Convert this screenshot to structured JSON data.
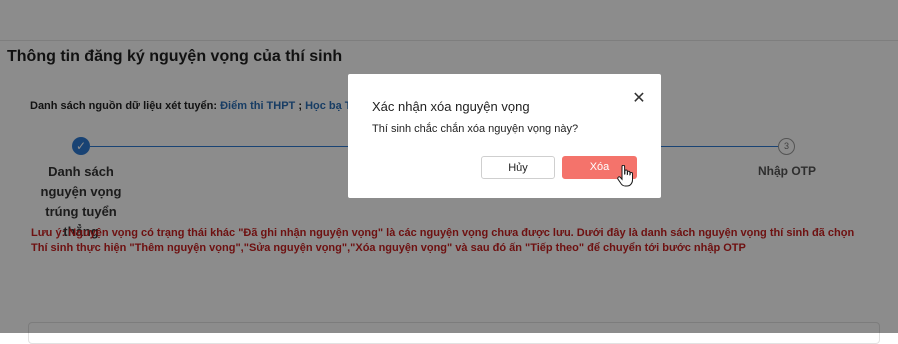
{
  "card": {
    "title": "Thông tin đăng ký nguyện vọng của thí sinh",
    "sources_label": "Danh sách nguồn dữ liệu xét tuyển:",
    "source_1": "Điểm thi THPT",
    "separator": ";",
    "source_2": "Học bạ TH"
  },
  "steps": {
    "step1_label": "Danh sách nguyện vọng trúng tuyển thẳng",
    "step1_icon": "check-icon",
    "step2_number": "3",
    "step2_label": "Nhập OTP",
    "active_color": "#2e7bd3"
  },
  "note": {
    "line1": "Lưu ý: Nguyện vọng có trạng thái khác \"Đã ghi nhận nguyện vọng\" là các nguyện vọng chưa được lưu. Dưới đây là danh sách nguyện vọng thí sinh đã chọn",
    "line2": "Thí sinh thực hiện \"Thêm nguyện vọng\",\"Sửa nguyện vọng\",\"Xóa nguyện vọng\" và sau đó ấn \"Tiếp theo\" để chuyển tới bước nhập OTP",
    "color": "#c81f1f"
  },
  "modal": {
    "title": "Xác nhận xóa nguyện vọng",
    "body": "Thí sinh chắc chắn xóa nguyện vọng này?",
    "close_glyph": "✕",
    "cancel_label": "Hủy",
    "delete_label": "Xóa",
    "delete_color": "#f4736b"
  }
}
